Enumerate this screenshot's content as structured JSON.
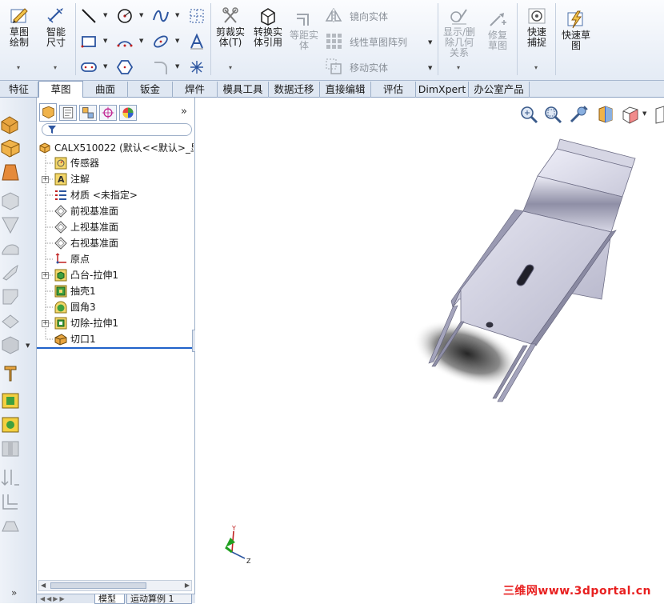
{
  "ribbon": {
    "sketch": "草图绘制",
    "smart_dimension": "智能尺寸",
    "trim": "剪裁实体(T)",
    "convert": "转换实体引用",
    "offset": "等距实体",
    "mirror": "镜向实体",
    "linear_pattern": "线性草图阵列",
    "move": "移动实体",
    "display_relations": "显示/删除几何关系",
    "repair": "修复草图",
    "quick_snaps": "快速捕捉",
    "rapid_sketch": "快速草图"
  },
  "tabs": [
    "特征",
    "草图",
    "曲面",
    "钣金",
    "焊件",
    "模具工具",
    "数据迁移",
    "直接编辑",
    "评估",
    "DimXpert",
    "办公室产品"
  ],
  "active_tab": "草图",
  "tree": {
    "root": "CALX510022  (默认<<默认>_显",
    "items": [
      {
        "label": "传感器",
        "icon": "sensor-icon",
        "expandable": false
      },
      {
        "label": "注解",
        "icon": "annotation-icon",
        "expandable": true
      },
      {
        "label": "材质 <未指定>",
        "icon": "material-icon",
        "expandable": false
      },
      {
        "label": "前视基准面",
        "icon": "plane-icon",
        "expandable": false
      },
      {
        "label": "上视基准面",
        "icon": "plane-icon",
        "expandable": false
      },
      {
        "label": "右视基准面",
        "icon": "plane-icon",
        "expandable": false
      },
      {
        "label": "原点",
        "icon": "origin-icon",
        "expandable": false
      },
      {
        "label": "凸台-拉伸1",
        "icon": "boss-extrude-icon",
        "expandable": true
      },
      {
        "label": "抽壳1",
        "icon": "shell-icon",
        "expandable": false
      },
      {
        "label": "圆角3",
        "icon": "fillet-icon",
        "expandable": false
      },
      {
        "label": "切除-拉伸1",
        "icon": "cut-extrude-icon",
        "expandable": true
      },
      {
        "label": "切口1",
        "icon": "rip-icon",
        "expandable": false
      }
    ]
  },
  "bottom_tabs": [
    "模型",
    "运动算例 1"
  ],
  "watermark": "三维网www.3dportal.cn",
  "colors": {
    "accent": "#1f62c9",
    "ribbon_bg": "#e4ebf5",
    "tab_bar": "#dfe7f2",
    "watermark": "#e82020"
  }
}
